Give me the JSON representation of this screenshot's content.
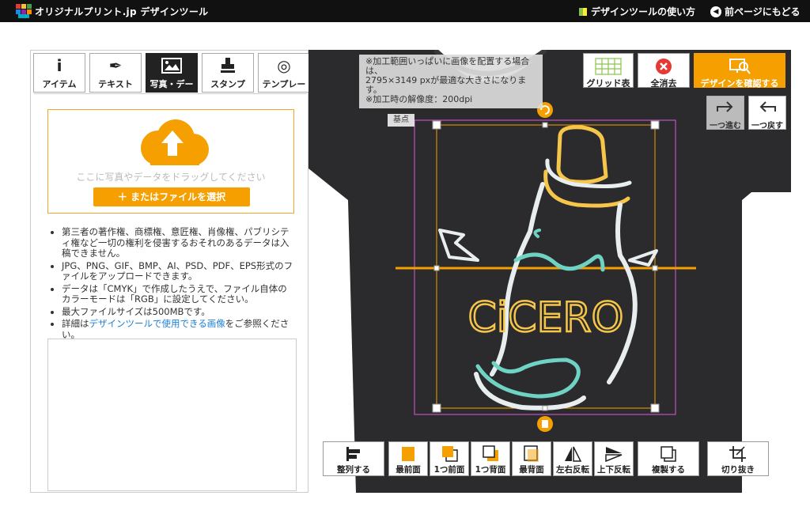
{
  "header": {
    "logo_text": "オリジナルプリント.jp デザインツール",
    "howto_label": "デザインツールの使い方",
    "back_label": "前ページにもどる"
  },
  "tabs": [
    {
      "label": "アイテム",
      "icon": "info-icon"
    },
    {
      "label": "テキスト",
      "icon": "pen-icon"
    },
    {
      "label": "写真・デー",
      "icon": "image-icon"
    },
    {
      "label": "スタンプ",
      "icon": "stamp-icon"
    },
    {
      "label": "テンプレー",
      "icon": "disc-icon"
    }
  ],
  "upload": {
    "drop_text": "ここに写真やデータをドラッグしてください",
    "select_label": "＋ またはファイルを選択"
  },
  "notes": {
    "n1": "第三者の著作権、商標権、意匠権、肖像権、パブリシティ権など一切の権利を侵害するおそれのあるデータは入稿できません。",
    "n2": "JPG、PNG、GIF、BMP、AI、PSD、PDF、EPS形式のファイルをアップロードできます。",
    "n3": "データは「CMYK」で作成したうえで、ファイル自体のカラーモードは「RGB」に設定してください。",
    "n4": "最大ファイルサイズは500MBです。",
    "n5_prefix": "詳細は",
    "n5_link": "デザインツールで使用できる画像",
    "n5_suffix": "をご参照ください。"
  },
  "canvas": {
    "note_line1": "※加工範囲いっぱいに画像を配置する場合は、",
    "note_line2": "2795×3149 pxが最適な大きさになります。",
    "note_line3": "※加工時の解像度：200dpi",
    "kiten_label": "基点",
    "design_text": "CiCERO"
  },
  "toolbar": {
    "grid_label": "グリッド表",
    "clear_label": "全消去",
    "confirm_label": "デザインを確認する",
    "redo_label": "一つ進む",
    "undo_label": "一つ戻す"
  },
  "bottom": {
    "align": "整列する",
    "front": "最前面",
    "forward": "1つ前面",
    "backward": "1つ背面",
    "back": "最背面",
    "flip_h": "左右反転",
    "flip_v": "上下反転",
    "duplicate": "複製する",
    "crop": "切り抜き"
  },
  "colors": {
    "accent": "#f5a000",
    "shirt": "#2b2b2d",
    "selection": "#c050c0"
  }
}
